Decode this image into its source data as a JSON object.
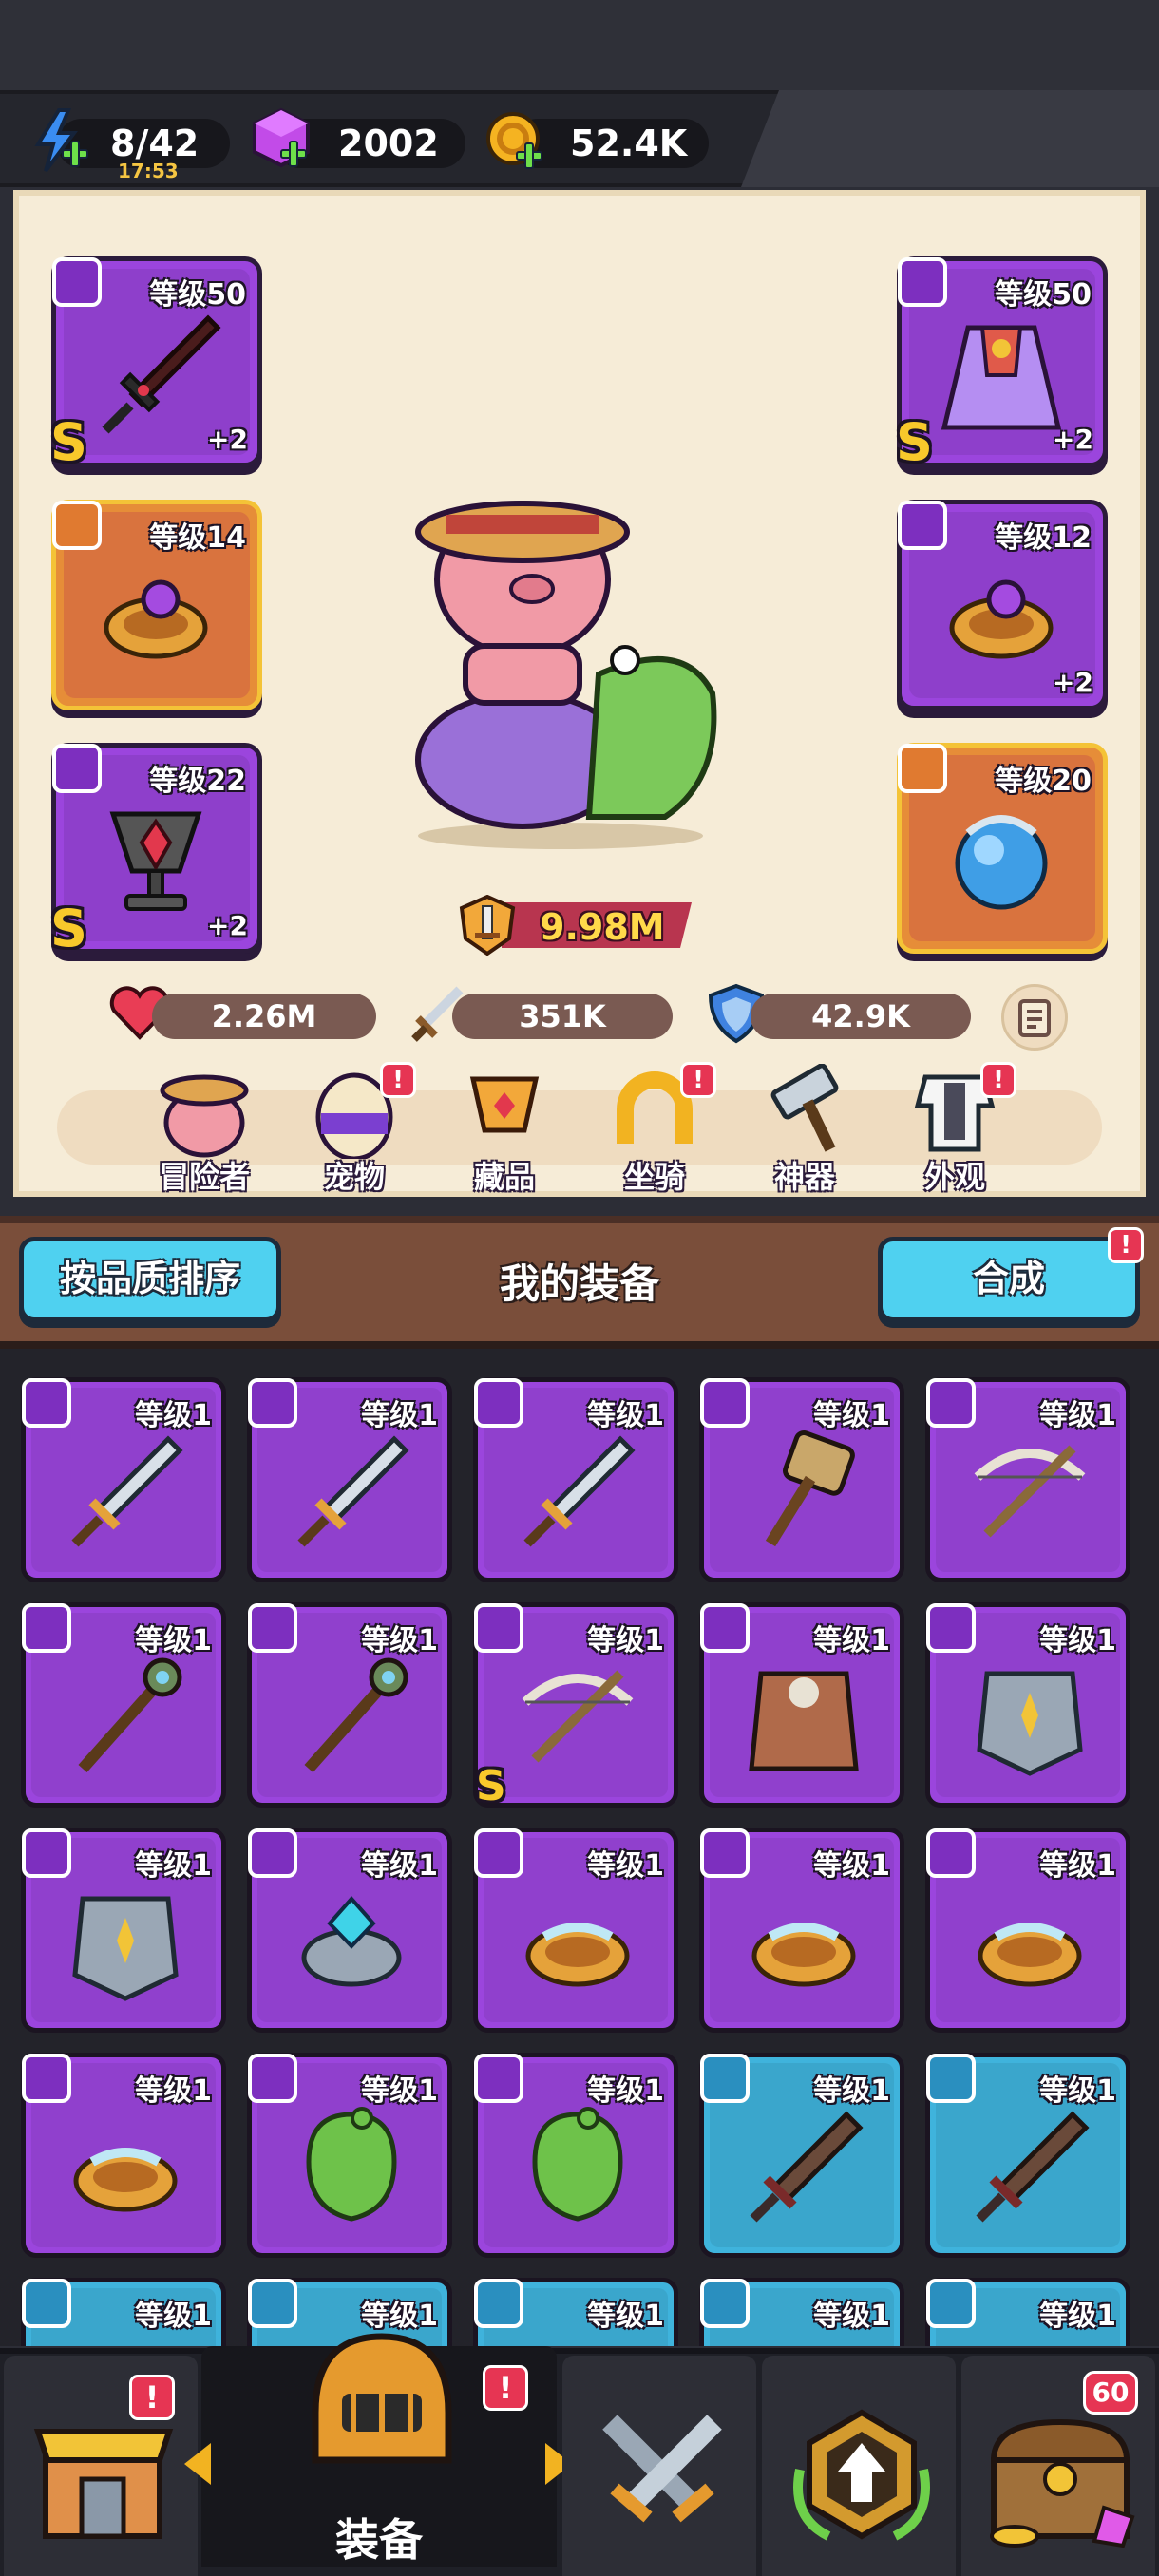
{
  "resources": {
    "energy": {
      "value": "8/42",
      "timer": "17:53",
      "icon": "lightning-icon"
    },
    "gems": {
      "value": "2002",
      "icon": "gem-cube-icon"
    },
    "gold": {
      "value": "52.4K",
      "icon": "gold-coin-icon"
    }
  },
  "equipped": {
    "left": [
      {
        "level": "等级50",
        "plus": "+2",
        "grade": "S",
        "slot": "weapon",
        "rarity": "purple"
      },
      {
        "level": "等级14",
        "plus": "",
        "grade": "",
        "slot": "ring",
        "rarity": "orange"
      },
      {
        "level": "等级22",
        "plus": "+2",
        "grade": "S",
        "slot": "necklace",
        "rarity": "purple"
      }
    ],
    "right": [
      {
        "level": "等级50",
        "plus": "+2",
        "grade": "S",
        "slot": "armor",
        "rarity": "purple"
      },
      {
        "level": "等级12",
        "plus": "+2",
        "grade": "",
        "slot": "ring",
        "rarity": "purple"
      },
      {
        "level": "等级20",
        "plus": "",
        "grade": "",
        "slot": "necklace",
        "rarity": "orange"
      }
    ]
  },
  "power": "9.98M",
  "stats": {
    "hp": "2.26M",
    "attack": "351K",
    "defense": "42.9K"
  },
  "menu": [
    {
      "label": "冒险者",
      "alert": false
    },
    {
      "label": "宠物",
      "alert": true
    },
    {
      "label": "藏品",
      "alert": false
    },
    {
      "label": "坐骑",
      "alert": true
    },
    {
      "label": "神器",
      "alert": false
    },
    {
      "label": "外观",
      "alert": true
    }
  ],
  "alert_mark": "!",
  "toolbar": {
    "sort_label": "按品质排序",
    "title": "我的装备",
    "merge_label": "合成"
  },
  "inventory": [
    {
      "level": "等级1",
      "rarity": "purple",
      "slot": "weapon",
      "item": "sword",
      "grade": ""
    },
    {
      "level": "等级1",
      "rarity": "purple",
      "slot": "weapon",
      "item": "sword",
      "grade": ""
    },
    {
      "level": "等级1",
      "rarity": "purple",
      "slot": "weapon",
      "item": "sword",
      "grade": ""
    },
    {
      "level": "等级1",
      "rarity": "purple",
      "slot": "weapon",
      "item": "hammer",
      "grade": ""
    },
    {
      "level": "等级1",
      "rarity": "purple",
      "slot": "weapon",
      "item": "crossbow",
      "grade": ""
    },
    {
      "level": "等级1",
      "rarity": "purple",
      "slot": "weapon",
      "item": "staff",
      "grade": ""
    },
    {
      "level": "等级1",
      "rarity": "purple",
      "slot": "weapon",
      "item": "staff",
      "grade": ""
    },
    {
      "level": "等级1",
      "rarity": "purple",
      "slot": "weapon",
      "item": "crossbow",
      "grade": "S"
    },
    {
      "level": "等级1",
      "rarity": "purple",
      "slot": "armor",
      "item": "leather-armor",
      "grade": ""
    },
    {
      "level": "等级1",
      "rarity": "purple",
      "slot": "armor",
      "item": "plate-armor",
      "grade": ""
    },
    {
      "level": "等级1",
      "rarity": "purple",
      "slot": "armor",
      "item": "plate-armor",
      "grade": ""
    },
    {
      "level": "等级1",
      "rarity": "purple",
      "slot": "ring",
      "item": "ring-gem",
      "grade": ""
    },
    {
      "level": "等级1",
      "rarity": "purple",
      "slot": "ring",
      "item": "ring",
      "grade": ""
    },
    {
      "level": "等级1",
      "rarity": "purple",
      "slot": "ring",
      "item": "ring",
      "grade": ""
    },
    {
      "level": "等级1",
      "rarity": "purple",
      "slot": "ring",
      "item": "ring",
      "grade": ""
    },
    {
      "level": "等级1",
      "rarity": "purple",
      "slot": "ring",
      "item": "ring",
      "grade": ""
    },
    {
      "level": "等级1",
      "rarity": "purple",
      "slot": "necklace",
      "item": "amulet",
      "grade": ""
    },
    {
      "level": "等级1",
      "rarity": "purple",
      "slot": "necklace",
      "item": "amulet",
      "grade": ""
    },
    {
      "level": "等级1",
      "rarity": "blue",
      "slot": "weapon",
      "item": "greatsword",
      "grade": ""
    },
    {
      "level": "等级1",
      "rarity": "blue",
      "slot": "weapon",
      "item": "greatsword",
      "grade": ""
    },
    {
      "level": "等级1",
      "rarity": "blue",
      "slot": "weapon",
      "item": "",
      "grade": ""
    },
    {
      "level": "等级1",
      "rarity": "blue",
      "slot": "weapon",
      "item": "",
      "grade": ""
    },
    {
      "level": "等级1",
      "rarity": "blue",
      "slot": "weapon",
      "item": "",
      "grade": ""
    },
    {
      "level": "等级1",
      "rarity": "blue",
      "slot": "weapon",
      "item": "",
      "grade": ""
    },
    {
      "level": "等级1",
      "rarity": "blue",
      "slot": "weapon",
      "item": "",
      "grade": ""
    }
  ],
  "nav": {
    "shop": {
      "icon": "shop-icon",
      "alert": true
    },
    "equipment": {
      "label": "装备",
      "icon": "helmet-icon",
      "alert": true
    },
    "battle": {
      "icon": "crossed-swords-icon"
    },
    "upgrade": {
      "icon": "upgrade-arrow-icon"
    },
    "chest": {
      "icon": "treasure-chest-icon",
      "badge": "60"
    }
  },
  "colors": {
    "purple": "#9b45dd",
    "orange": "#e68d38",
    "blue": "#3fb3dc",
    "accent_cyan": "#4fd1f0",
    "alert_red": "#e63553"
  }
}
